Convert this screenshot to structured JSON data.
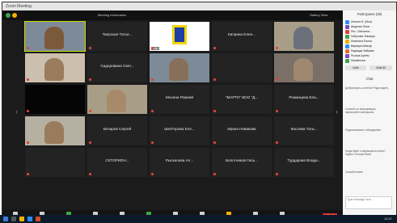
{
  "window": {
    "title": "Zoom Meeting"
  },
  "meeting_bar": {
    "view_label": "Gallery View",
    "info_label": "Meeting information"
  },
  "tiles": [
    {
      "name": "",
      "sub": "",
      "video": "person"
    },
    {
      "name": "Тверская Татья...",
      "sub": "",
      "video": "none"
    },
    {
      "name": "",
      "sub": "Logo",
      "video": "logo"
    },
    {
      "name": "Киприна Елен...",
      "sub": "",
      "video": "none"
    },
    {
      "name": "",
      "sub": "",
      "video": "person"
    },
    {
      "name": "",
      "sub": "",
      "video": "person"
    },
    {
      "name": "Сидоровина Свет...",
      "sub": "",
      "video": "none"
    },
    {
      "name": "",
      "sub": "",
      "video": "person"
    },
    {
      "name": "",
      "sub": "",
      "video": "none"
    },
    {
      "name": "",
      "sub": "",
      "video": "person"
    },
    {
      "name": "",
      "sub": "",
      "video": "dark"
    },
    {
      "name": "",
      "sub": "",
      "video": "person"
    },
    {
      "name": "Мосина Ромаей",
      "sub": "",
      "video": "none"
    },
    {
      "name": "\"МАРТО\" ВОО \"Д...",
      "sub": "",
      "video": "none"
    },
    {
      "name": "Романцева Ела...",
      "sub": "",
      "video": "none"
    },
    {
      "name": "",
      "sub": "",
      "video": "person"
    },
    {
      "name": "Бочаров Сергей",
      "sub": "",
      "video": "none"
    },
    {
      "name": "ШелГорова Еле...",
      "sub": "",
      "video": "none"
    },
    {
      "name": "Ирина Новикова",
      "sub": "",
      "video": "none"
    },
    {
      "name": "Кислова Тата...",
      "sub": "",
      "video": "none"
    },
    {
      "name": "",
      "sub": "",
      "video": "none"
    },
    {
      "name": "СКТОРИОН...",
      "sub": "",
      "video": "none"
    },
    {
      "name": "Рыскалева Ал...",
      "sub": "",
      "video": "none"
    },
    {
      "name": "Болотников Гиль...",
      "sub": "",
      "video": "none"
    },
    {
      "name": "Турдарова Влади...",
      "sub": "",
      "video": "none"
    }
  ],
  "toolbar": {
    "items": [
      "Mute",
      "Stop Video",
      "Security",
      "Participants",
      "Chat",
      "Share Screen",
      "Record",
      "Breakout Rooms",
      "Reactions",
      "Apps",
      "Whiteboards"
    ],
    "end_label": "End"
  },
  "panel": {
    "title": "Participants (38)",
    "participants": [
      "Ильина Н. (Моя)",
      "Шкурова Эльв...",
      "Ясс. Светлана...",
      "Хабулова Эльвира",
      "Левитина Елена",
      "Варвара Шевчук",
      "Надежда Зайцева",
      "Рычков Артём",
      "Михайлова"
    ],
    "invite_label": "Invite",
    "mute_all_label": "Mute All",
    "chat_title": "Chat",
    "chat_messages": [
      "Добрый день, коллеги! Рада видеть.",
      "Спасибо за информацию, присылайте материалы",
      "Подключаемся к обсуждению",
      "Когда будет следующая встреча? Ждём с нетерпением.",
      "Спасибо всем!"
    ],
    "input_placeholder": "Type message here..."
  },
  "taskbar": {
    "time": "12:47"
  }
}
